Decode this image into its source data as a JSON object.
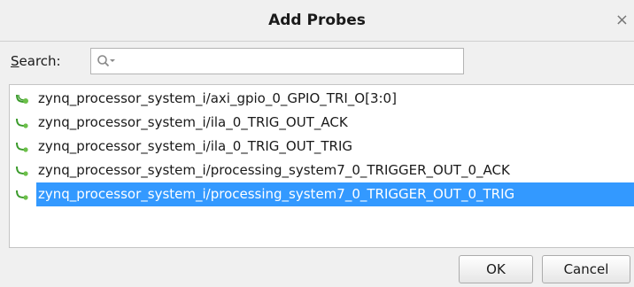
{
  "dialog": {
    "title": "Add Probes",
    "close_glyph": "×"
  },
  "search": {
    "label": "Search:",
    "value": "",
    "placeholder": ""
  },
  "probes": [
    {
      "label": "zynq_processor_system_i/axi_gpio_0_GPIO_TRI_O[3:0]",
      "icon": "bus-net-icon",
      "selected": false
    },
    {
      "label": "zynq_processor_system_i/ila_0_TRIG_OUT_ACK",
      "icon": "net-icon",
      "selected": false
    },
    {
      "label": "zynq_processor_system_i/ila_0_TRIG_OUT_TRIG",
      "icon": "net-icon",
      "selected": false
    },
    {
      "label": "zynq_processor_system_i/processing_system7_0_TRIGGER_OUT_0_ACK",
      "icon": "net-icon",
      "selected": false
    },
    {
      "label": "zynq_processor_system_i/processing_system7_0_TRIGGER_OUT_0_TRIG",
      "icon": "net-icon",
      "selected": true
    }
  ],
  "buttons": {
    "ok": "OK",
    "cancel": "Cancel"
  },
  "colors": {
    "selection": "#3399ff",
    "net_icon": "#3a9a2a"
  }
}
